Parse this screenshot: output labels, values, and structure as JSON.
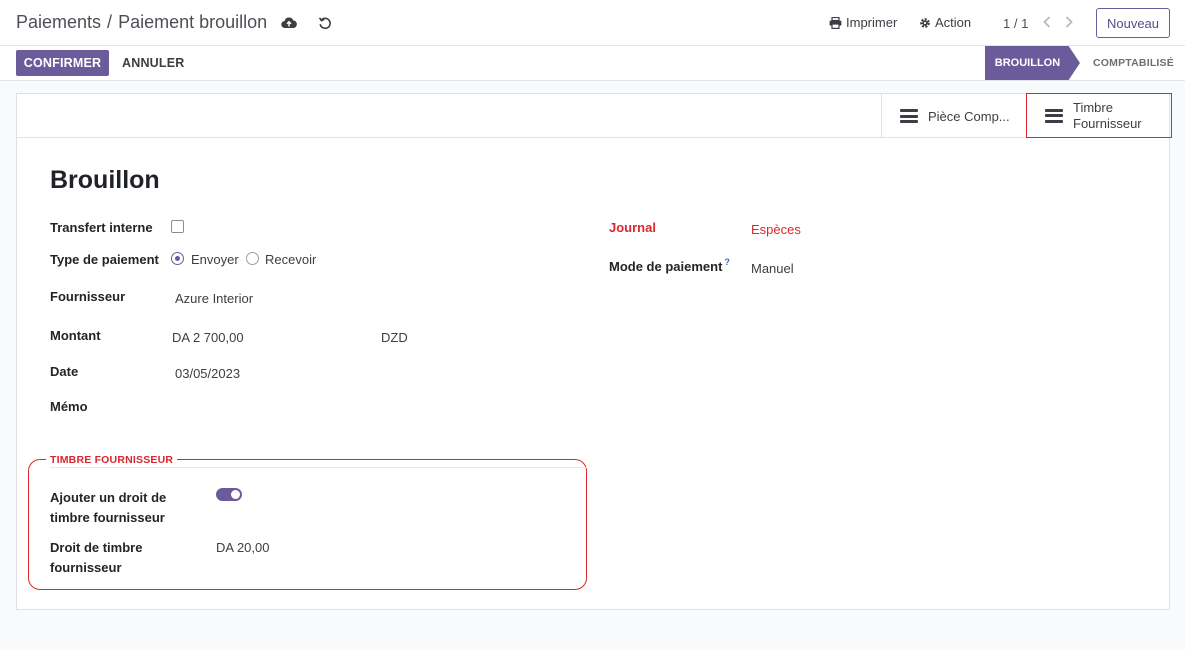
{
  "breadcrumb": {
    "parent": "Paiements",
    "separator": "/",
    "current": "Paiement brouillon"
  },
  "toolbar": {
    "print_label": "Imprimer",
    "action_label": "Action",
    "pager": "1 / 1",
    "new_label": "Nouveau"
  },
  "actions": {
    "confirm_label": "CONFIRMER",
    "cancel_label": "ANNULER"
  },
  "status": {
    "draft": "BROUILLON",
    "posted": "COMPTABILISÉ",
    "active": "BROUILLON"
  },
  "smart_buttons": {
    "journal_entry": "Pièce Comp...",
    "stamp_line1": "Timbre",
    "stamp_line2": "Fournisseur"
  },
  "form": {
    "title": "Brouillon",
    "internal_transfer_label": "Transfert interne",
    "internal_transfer_checked": false,
    "payment_type_label": "Type de paiement",
    "payment_type_send": "Envoyer",
    "payment_type_receive": "Recevoir",
    "payment_type_selected": "Envoyer",
    "partner_label": "Fournisseur",
    "partner_value": "Azure Interior",
    "amount_label": "Montant",
    "amount_value": "DA 2 700,00",
    "currency_value": "DZD",
    "date_label": "Date",
    "date_value": "03/05/2023",
    "memo_label": "Mémo",
    "journal_label": "Journal",
    "journal_value": "Espèces",
    "method_label": "Mode de paiement",
    "method_help": "?",
    "method_value": "Manuel"
  },
  "stamp_group": {
    "title": "TIMBRE FOURNISSEUR",
    "add_stamp_label_line1": "Ajouter un droit de",
    "add_stamp_label_line2": "timbre fournisseur",
    "add_stamp_enabled": true,
    "stamp_amount_label_line1": "Droit de timbre",
    "stamp_amount_label_line2": "fournisseur",
    "stamp_amount_value": "DA 20,00"
  },
  "colors": {
    "primary": "#6c5b9a",
    "highlight": "#d9272e"
  }
}
